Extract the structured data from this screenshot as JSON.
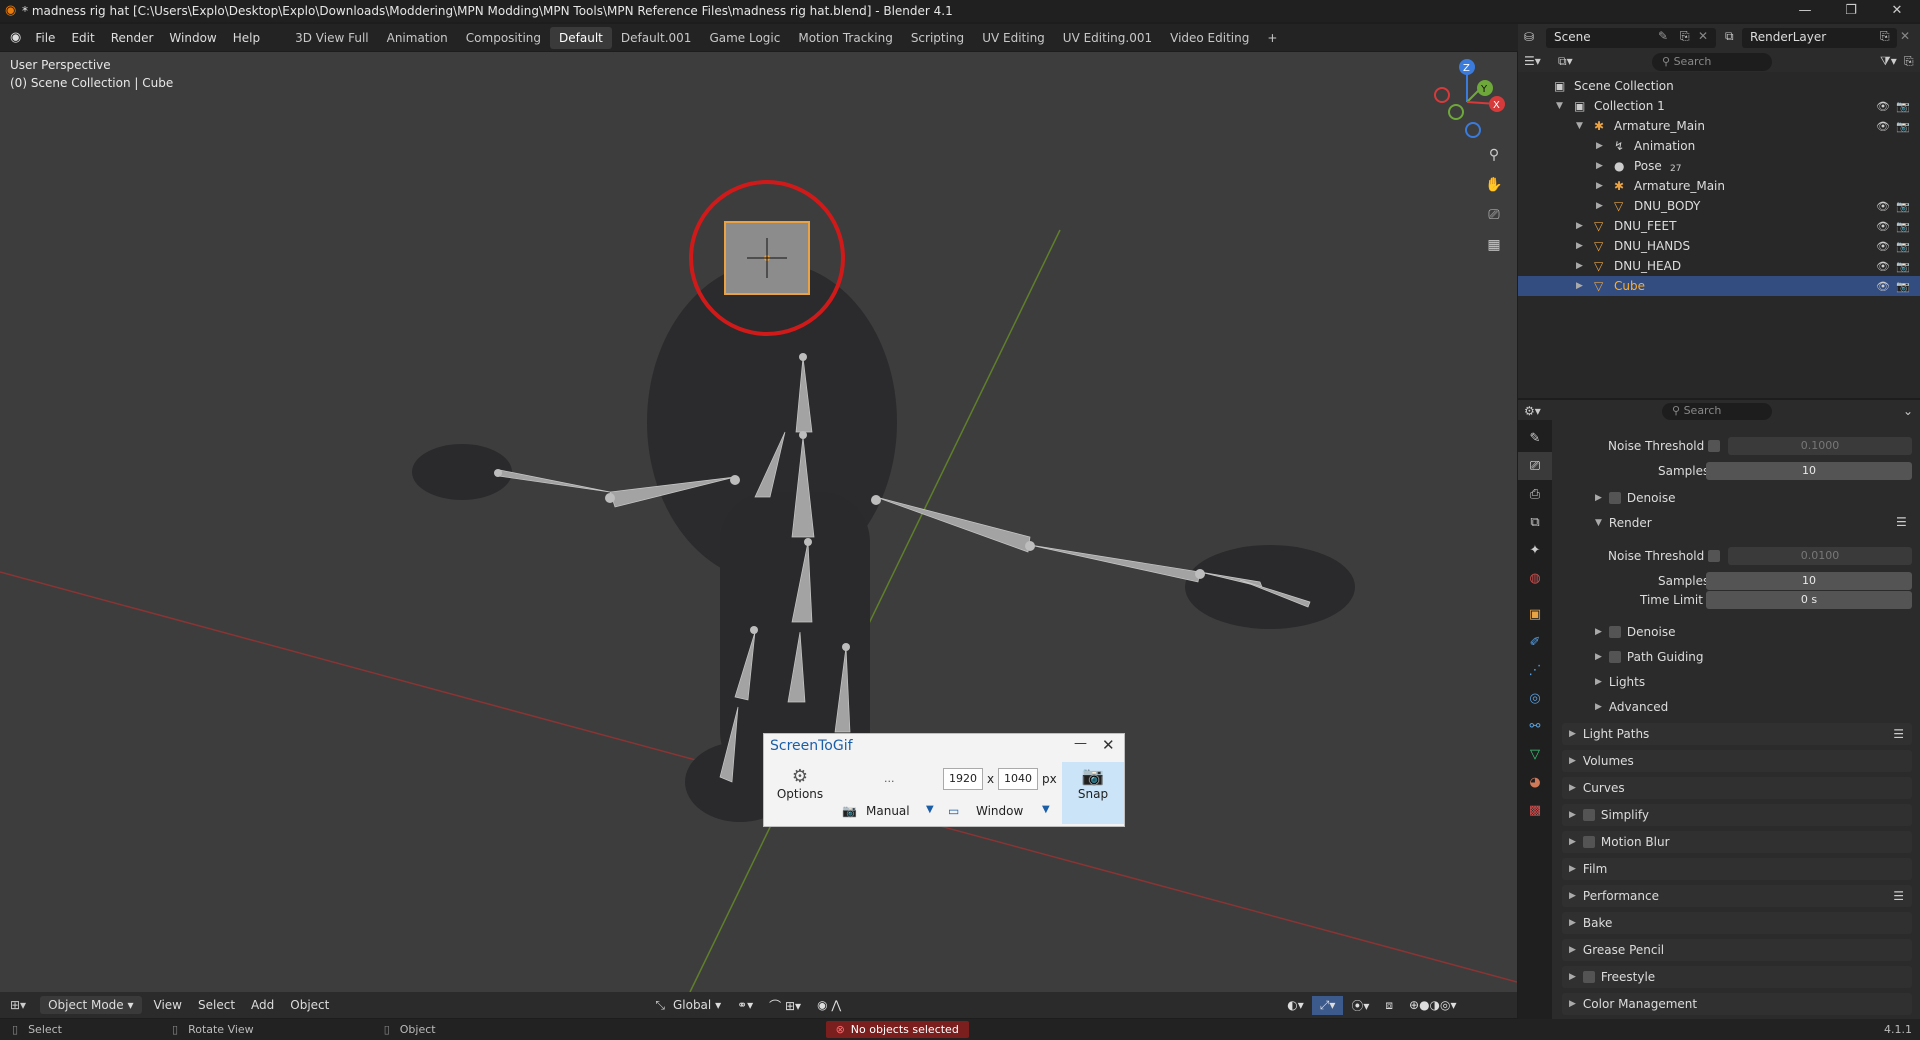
{
  "window": {
    "title": "* madness rig hat [C:\\Users\\Explo\\Desktop\\Explo\\Downloads\\Moddering\\MPN Modding\\MPN Tools\\MPN Reference Files\\madness rig hat.blend] - Blender 4.1",
    "minimize": "—",
    "restore": "❐",
    "close": "✕"
  },
  "menu": [
    "File",
    "Edit",
    "Render",
    "Window",
    "Help"
  ],
  "workspaces": [
    "3D View Full",
    "Animation",
    "Compositing",
    "Default",
    "Default.001",
    "Game Logic",
    "Motion Tracking",
    "Scripting",
    "UV Editing",
    "UV Editing.001",
    "Video Editing",
    "+"
  ],
  "active_workspace": "Default",
  "scene": {
    "scene_name": "Scene",
    "render_layer": "RenderLayer"
  },
  "viewport": {
    "perspective": "User Perspective",
    "collection": "(0) Scene Collection | Cube",
    "gizmo": {
      "z": "Z",
      "y": "Y",
      "x": "X"
    }
  },
  "toolbar": {
    "mode": "Object Mode",
    "view": "View",
    "select": "Select",
    "add": "Add",
    "object": "Object",
    "orientation": "Global"
  },
  "status": {
    "select": "Select",
    "rotate": "Rotate View",
    "object": "Object",
    "message": "No objects selected",
    "version": "4.1.1"
  },
  "outliner": {
    "search_placeholder": "Search",
    "rows": [
      {
        "label": "Scene Collection",
        "indent": 0,
        "icon": "▣"
      },
      {
        "label": "Collection 1",
        "indent": 1,
        "icon": "▣"
      },
      {
        "label": "Armature_Main",
        "indent": 2,
        "icon": "✱"
      },
      {
        "label": "Animation",
        "indent": 3,
        "icon": "↯"
      },
      {
        "label": "Pose",
        "indent": 3,
        "icon": "●",
        "badge": "27"
      },
      {
        "label": "Armature_Main",
        "indent": 3,
        "icon": "✱"
      },
      {
        "label": "DNU_BODY",
        "indent": 3,
        "icon": "▽"
      },
      {
        "label": "DNU_FEET",
        "indent": 2,
        "icon": "▽"
      },
      {
        "label": "DNU_HANDS",
        "indent": 2,
        "icon": "▽"
      },
      {
        "label": "DNU_HEAD",
        "indent": 2,
        "icon": "▽"
      },
      {
        "label": "Cube",
        "indent": 2,
        "icon": "▽",
        "selected": true
      }
    ]
  },
  "properties": {
    "search_placeholder": "Search",
    "noise_threshold_label": "Noise Threshold",
    "noise_threshold_value": "0.1000",
    "samples_label": "Samples",
    "samples_value": "10",
    "denoise": "Denoise",
    "render": "Render",
    "render_noise_threshold_value": "0.0100",
    "render_samples_value": "10",
    "time_limit_label": "Time Limit",
    "time_limit_value": "0 s",
    "denoise2": "Denoise",
    "path_guiding": "Path Guiding",
    "lights": "Lights",
    "advanced": "Advanced",
    "panels": [
      "Light Paths",
      "Volumes",
      "Curves",
      "Simplify",
      "Motion Blur",
      "Film",
      "Performance",
      "Bake",
      "Grease Pencil",
      "Freestyle",
      "Color Management"
    ]
  },
  "screentogif": {
    "title": "ScreenToGif",
    "options": "Options",
    "dots": "...",
    "width": "1920",
    "height": "1040",
    "x": "x",
    "px": "px",
    "manual": "Manual",
    "window": "Window",
    "snap": "Snap",
    "min": "—",
    "close": "✕"
  },
  "colors": {
    "accent": "#e8a346",
    "selection": "#334d80",
    "circle": "#d01a1a"
  }
}
